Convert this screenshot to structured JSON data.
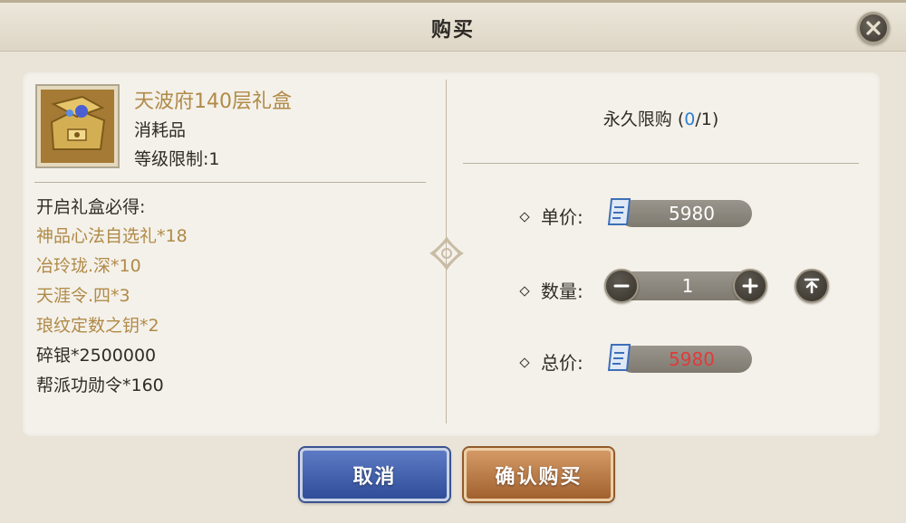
{
  "dialog": {
    "title": "购买",
    "close_icon": "close-icon"
  },
  "item": {
    "name": "天波府140层礼盒",
    "type": "消耗品",
    "level_limit": "等级限制:1",
    "icon": "treasure-chest-icon",
    "name_color": "#b08a48"
  },
  "contents": {
    "title": "开启礼盒必得:",
    "rewards": [
      {
        "text": "神品心法自选礼*18",
        "color": "#b08a48"
      },
      {
        "text": "冶玲珑.深*10",
        "color": "#b08a48"
      },
      {
        "text": "天涯令.四*3",
        "color": "#b08a48"
      },
      {
        "text": "琅纹定数之钥*2",
        "color": "#b08a48"
      },
      {
        "text": "碎银*2500000",
        "color": "#2f2b26"
      },
      {
        "text": "帮派功勋令*160",
        "color": "#2f2b26"
      }
    ]
  },
  "purchase": {
    "limit_label": "永久限购",
    "limit_open": "(",
    "limit_current": "0",
    "limit_sep": "/",
    "limit_max": "1",
    "limit_close": ")",
    "unit_price_label": "单价:",
    "unit_price": "5980",
    "quantity_label": "数量:",
    "quantity": "1",
    "total_label": "总价:",
    "total_price": "5980",
    "total_color": "#e03b3b",
    "currency_icon": "scroll-ticket-icon"
  },
  "buttons": {
    "cancel": "取消",
    "confirm": "确认购买"
  }
}
